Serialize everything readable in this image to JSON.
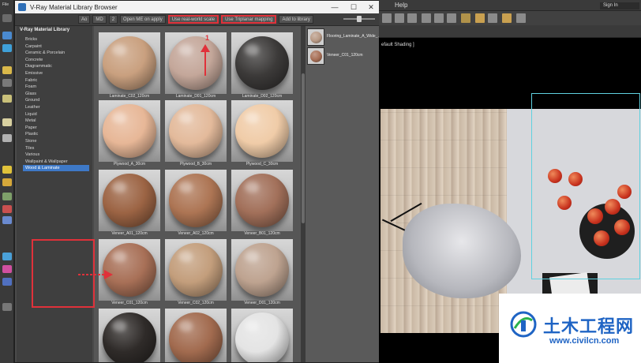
{
  "window": {
    "title": "V-Ray Material Library Browser",
    "controls": {
      "minimize": "—",
      "maximize": "☐",
      "close": "✕"
    }
  },
  "host": {
    "menu_file": "File",
    "menu_help": "Help",
    "sign_in": "Sign In",
    "viewport_label": "efault Shading ]"
  },
  "toolbar": {
    "buttons": [
      {
        "label": "Ao"
      },
      {
        "label": "MD"
      },
      {
        "label": "2"
      },
      {
        "label": "Open ME on apply"
      },
      {
        "label": "Use real-world scale",
        "highlight": true
      },
      {
        "label": "Use Triplanar mapping",
        "highlight": true
      },
      {
        "label": "Add to library"
      }
    ],
    "slider_level": 0.5
  },
  "tree": {
    "root": "V-Ray Material Library",
    "items": [
      "Bricks",
      "Carpaint",
      "Ceramic & Porcelain",
      "Concrete",
      "Diagrammatic",
      "Emissive",
      "Fabric",
      "Foam",
      "Glass",
      "Ground",
      "Leather",
      "Liquid",
      "Metal",
      "Paper",
      "Plastic",
      "Stone",
      "Tiles",
      "Various",
      "Wallpaint & Wallpaper",
      "Wood & Laminate"
    ],
    "selected_index": 19
  },
  "materials": [
    {
      "label": "Laminate_C02_120cm",
      "color": "#c9a07f"
    },
    {
      "label": "Laminate_D01_120cm",
      "color": "#c4a79a"
    },
    {
      "label": "Laminate_D02_120cm",
      "color": "#3c3a39"
    },
    {
      "label": "Plywood_A_30cm",
      "color": "#e7b797"
    },
    {
      "label": "Plywood_B_30cm",
      "color": "#e3ba9b"
    },
    {
      "label": "Plywood_C_30cm",
      "color": "#f0cca8"
    },
    {
      "label": "Veneer_A01_120cm",
      "color": "#9c6444"
    },
    {
      "label": "Veneer_A02_120cm",
      "color": "#ad7554"
    },
    {
      "label": "Veneer_B01_120cm",
      "color": "#a2705a"
    },
    {
      "label": "Veneer_C01_120cm",
      "color": "#a87057"
    },
    {
      "label": "Veneer_C02_120cm",
      "color": "#c39e7c"
    },
    {
      "label": "Veneer_D01_120cm",
      "color": "#bea390"
    },
    {
      "label": "",
      "color": "#2f2b29"
    },
    {
      "label": "",
      "color": "#a26b4f"
    },
    {
      "label": "",
      "color": "#e4e4e4"
    }
  ],
  "applied": [
    {
      "label": "Flooring_Laminate_A_Wide_...",
      "color": "#b89a86"
    },
    {
      "label": "Veneer_C01_120cm",
      "color": "#a87057"
    }
  ],
  "annotation": {
    "step_number": "1"
  },
  "watermark": {
    "text_cn": "土木工程网",
    "url": "www.civilcn.com"
  }
}
